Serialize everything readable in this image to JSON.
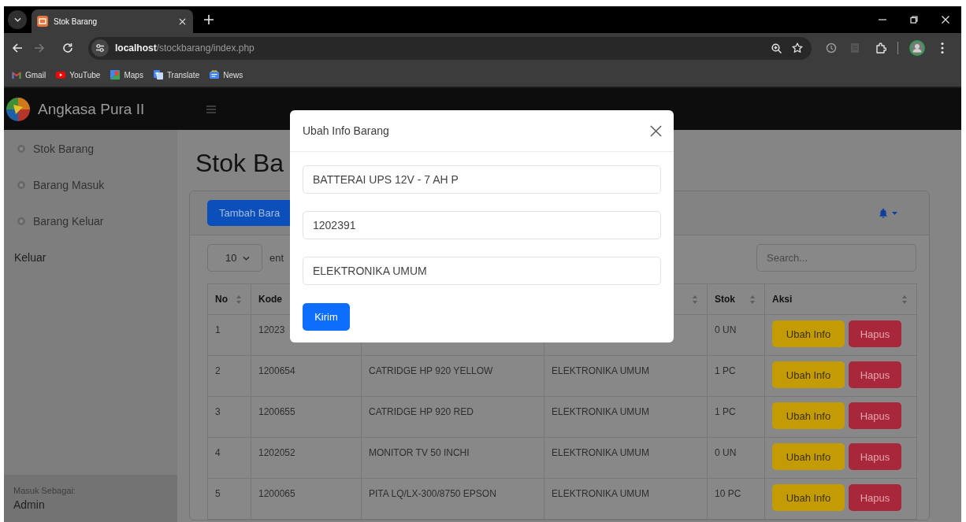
{
  "browser": {
    "tabs": [
      {
        "title": "Stok Barang",
        "selected": true
      }
    ],
    "url": "**localhost**/stockbarang/index.php",
    "bookmarks": [
      {
        "label": "Gmail"
      },
      {
        "label": "YouTube"
      },
      {
        "label": "Maps"
      },
      {
        "label": "Translate"
      },
      {
        "label": "News"
      }
    ]
  },
  "navbar": {
    "brand": "Angkasa Pura II"
  },
  "sidebar": {
    "items": [
      {
        "label": "Stok Barang",
        "kind": "menu"
      },
      {
        "label": "Barang Masuk",
        "kind": "menu"
      },
      {
        "label": "Barang Keluar",
        "kind": "menu"
      },
      {
        "label": "Keluar",
        "kind": "action"
      }
    ],
    "footer": {
      "caption": "Masuk Sebagai:",
      "user": "Admin"
    }
  },
  "content": {
    "title": "Stok Ba",
    "add_button": "Tambah Bara",
    "entries": {
      "value": "10",
      "label": "ent"
    },
    "search": {
      "placeholder": "Search..."
    }
  },
  "table": {
    "columns": [
      {
        "label": "No",
        "sortable": true
      },
      {
        "label": "Kode"
      },
      {},
      {
        "sortable": true
      },
      {
        "label": "Stok",
        "sortable": true
      },
      {
        "label": "Aksi",
        "sortable": true
      }
    ],
    "rows": [
      {
        "no": "1",
        "kode": "12023",
        "stok": "0 UN",
        "actions": [
          {
            "label": "Ubah Info",
            "kind": "edit"
          },
          {
            "label": "Hapus",
            "kind": "delete"
          }
        ]
      },
      {
        "no": "2",
        "kode": "1200654",
        "column_3": "CATRIDGE HP 920 YELLOW",
        "column_4": "ELEKTRONIKA UMUM",
        "stok": "1 PC",
        "actions": [
          {
            "label": "Ubah Info",
            "kind": "edit"
          },
          {
            "label": "Hapus",
            "kind": "delete"
          }
        ]
      },
      {
        "no": "3",
        "kode": "1200655",
        "column_3": "CATRIDGE HP 920 RED",
        "column_4": "ELEKTRONIKA UMUM",
        "stok": "1 PC",
        "actions": [
          {
            "label": "Ubah Info",
            "kind": "edit"
          },
          {
            "label": "Hapus",
            "kind": "delete"
          }
        ]
      },
      {
        "no": "4",
        "kode": "1202052",
        "column_3": "MONITOR TV 50 INCHI",
        "column_4": "ELEKTRONIKA UMUM",
        "stok": "0 UN",
        "actions": [
          {
            "label": "Ubah Info",
            "kind": "edit"
          },
          {
            "label": "Hapus",
            "kind": "delete"
          }
        ]
      },
      {
        "no": "5",
        "kode": "1200065",
        "column_3": "PITA LQ/LX-300/8750 EPSON",
        "column_4": "ELEKTRONIKA UMUM",
        "stok": "10 PC",
        "actions": [
          {
            "label": "Ubah Info",
            "kind": "edit"
          },
          {
            "label": "Hapus",
            "kind": "delete"
          }
        ]
      }
    ]
  },
  "modal": {
    "title": "Ubah Info Barang",
    "fields": [
      {
        "value": "BATTERAI UPS 12V - 7 AH P"
      },
      {
        "value": "1202391"
      },
      {
        "value": "ELEKTRONIKA UMUM"
      }
    ],
    "submit": "Kirim"
  }
}
